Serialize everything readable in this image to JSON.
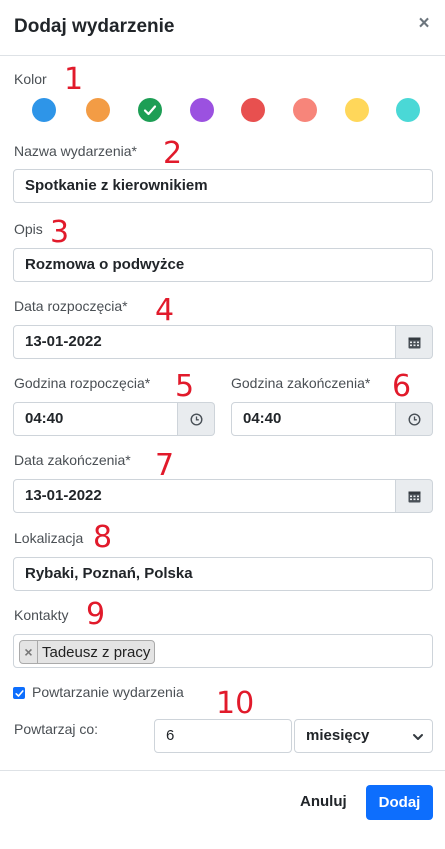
{
  "header": {
    "title": "Dodaj wydarzenie",
    "close_glyph": "×"
  },
  "color": {
    "label": "Kolor",
    "options": [
      {
        "name": "blue",
        "hex": "#2e95e8",
        "selected": false
      },
      {
        "name": "orange",
        "hex": "#f39c45",
        "selected": false
      },
      {
        "name": "green",
        "hex": "#1d9e55",
        "selected": true
      },
      {
        "name": "purple",
        "hex": "#9b51e0",
        "selected": false
      },
      {
        "name": "red",
        "hex": "#e8504f",
        "selected": false
      },
      {
        "name": "salmon",
        "hex": "#f7857a",
        "selected": false
      },
      {
        "name": "yellow",
        "hex": "#ffd75a",
        "selected": false
      },
      {
        "name": "cyan",
        "hex": "#4ad8d6",
        "selected": false
      }
    ]
  },
  "fields": {
    "name": {
      "label": "Nazwa wydarzenia*",
      "value": "Spotkanie z kierownikiem"
    },
    "description": {
      "label": "Opis",
      "value": "Rozmowa o podwyżce"
    },
    "start_date": {
      "label": "Data rozpoczęcia*",
      "value": "13-01-2022",
      "icon": "calendar-icon"
    },
    "start_time": {
      "label": "Godzina rozpoczęcia*",
      "value": "04:40",
      "icon": "clock-icon"
    },
    "end_time": {
      "label": "Godzina zakończenia*",
      "value": "04:40",
      "icon": "clock-icon"
    },
    "end_date": {
      "label": "Data zakończenia*",
      "value": "13-01-2022",
      "icon": "calendar-icon"
    },
    "location": {
      "label": "Lokalizacja",
      "value": "Rybaki, Poznań, Polska"
    },
    "contacts": {
      "label": "Kontakty",
      "tags": [
        {
          "remove_glyph": "×",
          "label": "Tadeusz z pracy"
        }
      ]
    }
  },
  "repeat": {
    "checkbox_label": "Powtarzanie wydarzenia",
    "checked": true,
    "every_label": "Powtarzaj co:",
    "every_value": "6",
    "unit_selected": "miesięcy"
  },
  "annotations": [
    "1",
    "2",
    "3",
    "4",
    "5",
    "6",
    "7",
    "8",
    "9",
    "10"
  ],
  "footer": {
    "cancel_label": "Anuluj",
    "submit_label": "Dodaj"
  },
  "accent": "#0d6efd"
}
